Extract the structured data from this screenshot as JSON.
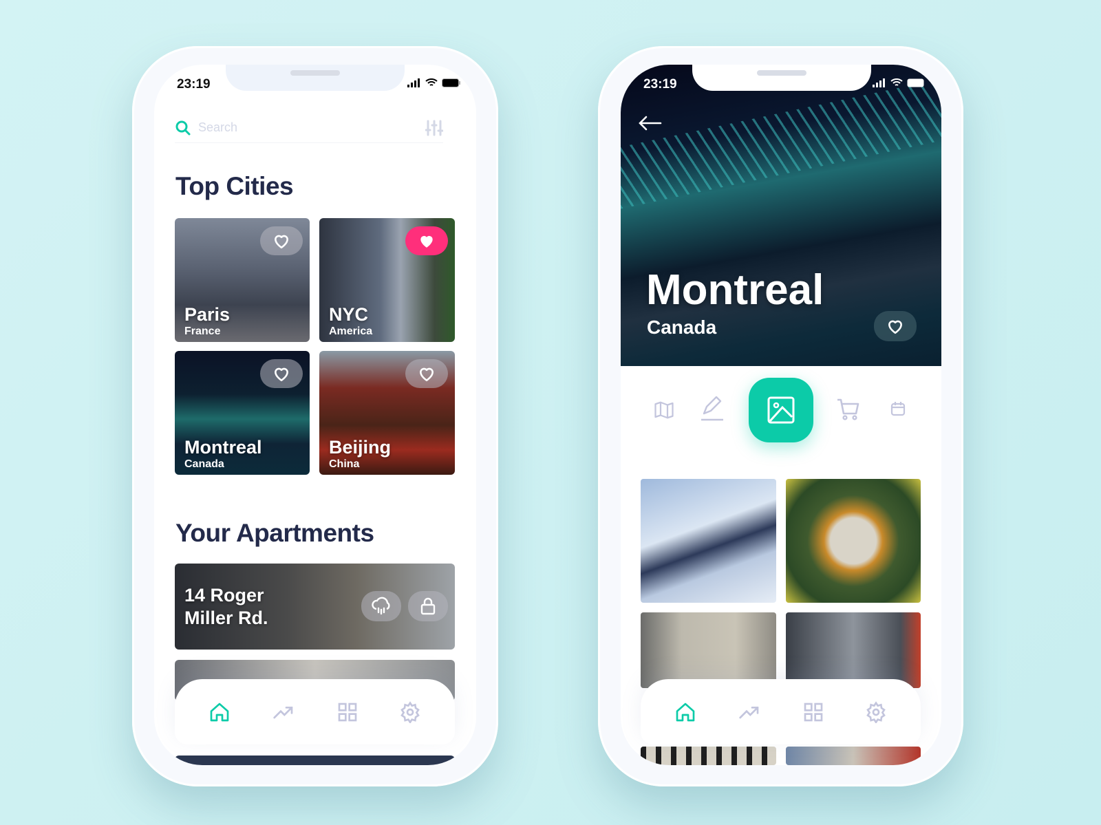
{
  "colors": {
    "accent": "#0ccba8",
    "heart_active": "#ff2f7b",
    "heading": "#232a4a",
    "icon_muted": "#c3c5dd"
  },
  "left": {
    "status": {
      "time": "23:19"
    },
    "search": {
      "placeholder": "Search",
      "icon": "search-icon",
      "filter_icon": "sliders-icon"
    },
    "top_cities_title": "Top Cities",
    "cities": [
      {
        "name": "Paris",
        "country": "France",
        "favorite": false
      },
      {
        "name": "NYC",
        "country": "America",
        "favorite": true
      },
      {
        "name": "Montreal",
        "country": "Canada",
        "favorite": false
      },
      {
        "name": "Beijing",
        "country": "China",
        "favorite": false
      }
    ],
    "apartments_title": "Your Apartments",
    "apartments": [
      {
        "address_line1": "14 Roger",
        "address_line2": "Miller Rd.",
        "icons": [
          "cloud-rain-icon",
          "lock-icon"
        ]
      }
    ],
    "nav": [
      "home-icon",
      "trending-icon",
      "grid-icon",
      "settings-icon"
    ],
    "nav_active": "home-icon"
  },
  "right": {
    "status": {
      "time": "23:19"
    },
    "city": "Montreal",
    "country": "Canada",
    "favorite": false,
    "tabs": [
      "map-icon",
      "edit-icon",
      "image-icon",
      "cart-icon",
      "calendar-icon"
    ],
    "active_tab": "image-icon",
    "nav": [
      "home-icon",
      "trending-icon",
      "grid-icon",
      "settings-icon"
    ],
    "nav_active": "home-icon"
  }
}
